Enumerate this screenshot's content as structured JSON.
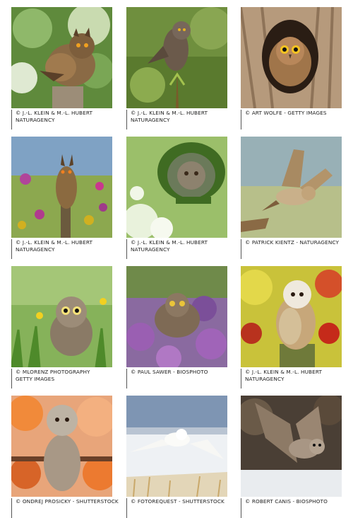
{
  "photos": [
    {
      "line1": "© J.-L. KLEIN & M.-L. HUBERT",
      "line2": "NATURAGENCY",
      "subject": "eagle-owl-on-stump"
    },
    {
      "line1": "© J.-L. KLEIN & M.-L. HUBERT",
      "line2": "NATURAGENCY",
      "subject": "owl-on-branch-green"
    },
    {
      "line1": "© ART WOLFE - GETTY IMAGES",
      "line2": "",
      "subject": "owl-in-tree-hollow"
    },
    {
      "line1": "© J.-L. KLEIN & M.-L. HUBERT",
      "line2": "NATURAGENCY",
      "subject": "long-eared-owl-flowers"
    },
    {
      "line1": "© J.-L. KLEIN & M.-L. HUBERT",
      "line2": "NATURAGENCY",
      "subject": "owl-in-moss-nest"
    },
    {
      "line1": "© PATRICK KIENTZ - NATURAGENCY",
      "line2": "",
      "subject": "owl-landing-flight"
    },
    {
      "line1": "© MLORENZ PHOTOGRAPHY",
      "line2": "GETTY IMAGES",
      "subject": "owl-in-grass"
    },
    {
      "line1": "© PAUL SAWER - BIOSPHOTO",
      "line2": "",
      "subject": "owl-in-heather"
    },
    {
      "line1": "© J.-L. KLEIN & M.-L. HUBERT",
      "line2": "NATURAGENCY",
      "subject": "barn-owl-red-berries"
    },
    {
      "line1": "© ONDREJ PROSICKY - SHUTTERSTOCK",
      "line2": "",
      "subject": "owl-autumn-leaves"
    },
    {
      "line1": "© FOTOREQUEST - SHUTTERSTOCK",
      "line2": "",
      "subject": "snowy-owl-flight"
    },
    {
      "line1": "© ROBERT CANIS - BIOSPHOTO",
      "line2": "",
      "subject": "owl-flight-snow"
    }
  ]
}
